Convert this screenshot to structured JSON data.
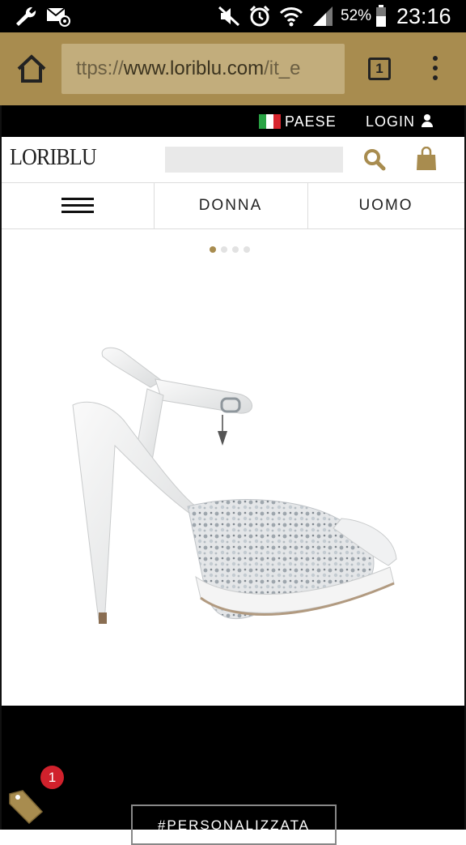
{
  "status_bar": {
    "battery_percent": "52%",
    "time": "23:16",
    "icons": [
      "wrench-icon",
      "mail-at-icon",
      "mute-icon",
      "alarm-icon",
      "wifi-icon",
      "signal-icon",
      "battery-icon"
    ]
  },
  "browser": {
    "url_prefix": "ttps://",
    "url_domain": "www.loriblu.com",
    "url_path": "/it_e",
    "tab_count": "1",
    "colors": {
      "toolbar": "#a88c4f",
      "url_box": "#c2ad7c"
    }
  },
  "site": {
    "topbar": {
      "country_label": "PAESE",
      "login_label": "LOGIN"
    },
    "logo": "LORIBLU",
    "search": {
      "placeholder": ""
    },
    "nav": {
      "women_label": "DONNA",
      "men_label": "UOMO"
    },
    "carousel": {
      "slide_count": 4,
      "active_index": 0
    },
    "cta_label": "#PERSONALIZZATA",
    "accent_color": "#a88c4f"
  },
  "floating": {
    "badge_count": "1"
  }
}
